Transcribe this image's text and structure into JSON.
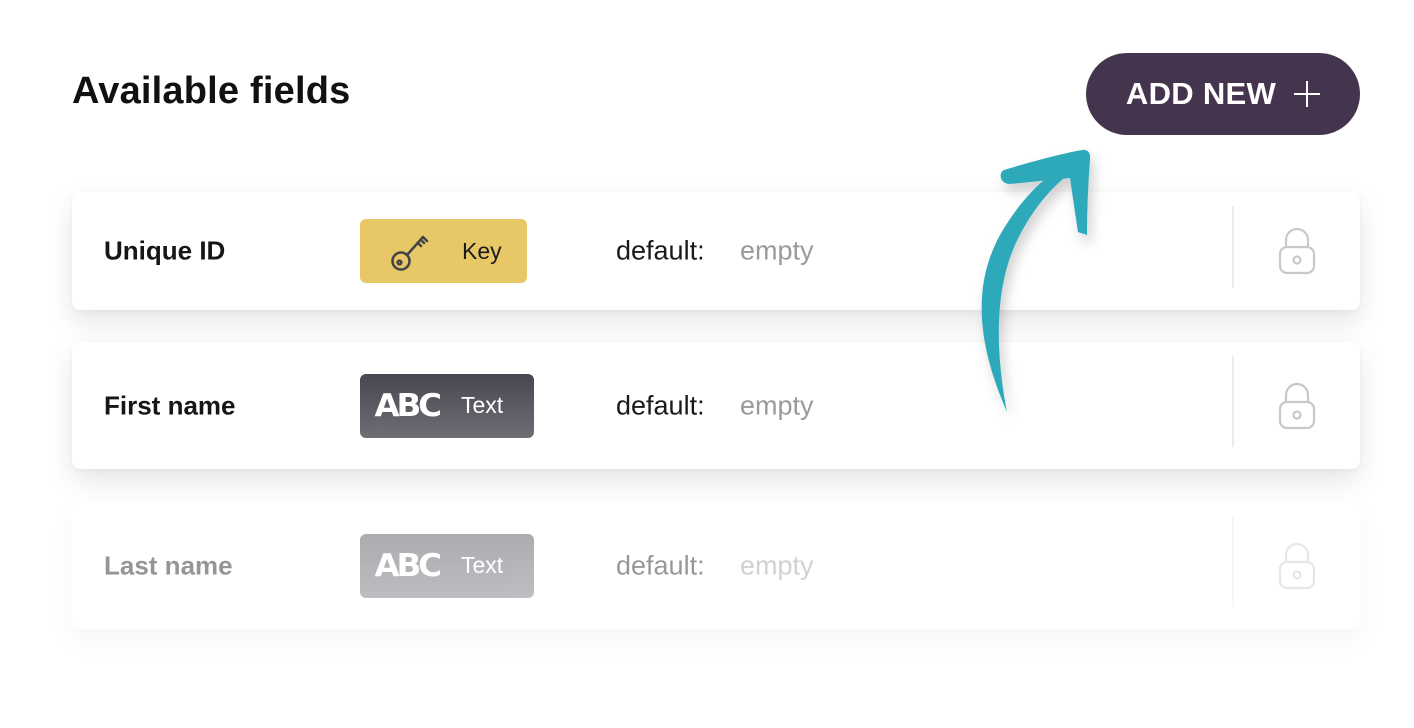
{
  "header": {
    "title": "Available fields",
    "add_button_label": "ADD NEW",
    "add_button_icon": "plus-icon",
    "accent_color": "#45344d"
  },
  "annotation": {
    "icon": "curved-arrow-icon",
    "color": "#2ea9b9"
  },
  "fields": [
    {
      "name": "Unique ID",
      "type_icon": "key-icon",
      "type_label": "Key",
      "type_color": "#e8c866",
      "default_label": "default:",
      "default_value": "empty",
      "lock_icon": "lock-icon",
      "state": "active"
    },
    {
      "name": "First name",
      "type_icon": "abc-icon",
      "type_icon_text": "ABC",
      "type_label": "Text",
      "type_color": "#4a4650",
      "default_label": "default:",
      "default_value": "empty",
      "lock_icon": "lock-icon",
      "state": "active"
    },
    {
      "name": "Last name",
      "type_icon": "abc-icon",
      "type_icon_text": "ABC",
      "type_label": "Text",
      "type_color": "#4a4650",
      "default_label": "default:",
      "default_value": "empty",
      "lock_icon": "lock-icon",
      "state": "faded"
    }
  ]
}
